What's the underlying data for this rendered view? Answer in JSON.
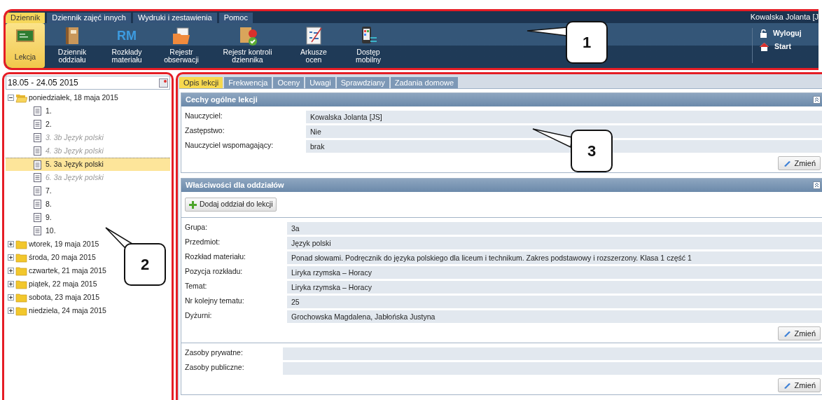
{
  "menu_tabs": [
    {
      "label": "Dziennik",
      "selected": true
    },
    {
      "label": "Dziennik zajęć innych",
      "selected": false
    },
    {
      "label": "Wydruki i zestawienia",
      "selected": false
    },
    {
      "label": "Pomoc",
      "selected": false
    }
  ],
  "user": "Kowalska Jolanta [J",
  "ribbon": [
    {
      "label": "Lekcja",
      "selected": true
    },
    {
      "label": "Dziennik oddziału",
      "selected": false
    },
    {
      "label": "Rozkłady materiału",
      "selected": false,
      "badge": "RM"
    },
    {
      "label": "Rejestr obserwacji",
      "selected": false
    },
    {
      "label": "Rejestr kontroli dziennika",
      "selected": false
    },
    {
      "label": "Arkusze ocen",
      "selected": false
    },
    {
      "label": "Dostęp mobilny",
      "selected": false
    }
  ],
  "account_actions": [
    {
      "label": "Wyloguj"
    },
    {
      "label": "Start"
    }
  ],
  "date_range": "18.05 - 24.05 2015",
  "tree": [
    {
      "label": "poniedziałek, 18 maja 2015",
      "expanded": true,
      "children": [
        {
          "label": "1.",
          "selected": false,
          "disabled": false
        },
        {
          "label": "2.",
          "selected": false,
          "disabled": false
        },
        {
          "label": "3. 3b Język polski",
          "selected": false,
          "disabled": true
        },
        {
          "label": "4. 3b Język polski",
          "selected": false,
          "disabled": true
        },
        {
          "label": "5. 3a Język polski",
          "selected": true,
          "disabled": false
        },
        {
          "label": "6. 3a Język polski",
          "selected": false,
          "disabled": true
        },
        {
          "label": "7.",
          "selected": false,
          "disabled": false
        },
        {
          "label": "8.",
          "selected": false,
          "disabled": false
        },
        {
          "label": "9.",
          "selected": false,
          "disabled": false
        },
        {
          "label": "10.",
          "selected": false,
          "disabled": false
        }
      ]
    },
    {
      "label": "wtorek, 19 maja 2015",
      "expanded": false
    },
    {
      "label": "środa, 20 maja 2015",
      "expanded": false
    },
    {
      "label": "czwartek, 21 maja 2015",
      "expanded": false
    },
    {
      "label": "piątek, 22 maja 2015",
      "expanded": false
    },
    {
      "label": "sobota, 23 maja 2015",
      "expanded": false
    },
    {
      "label": "niedziela, 24 maja 2015",
      "expanded": false
    }
  ],
  "content_tabs": [
    {
      "label": "Opis lekcji",
      "selected": true
    },
    {
      "label": "Frekwencja",
      "selected": false
    },
    {
      "label": "Oceny",
      "selected": false
    },
    {
      "label": "Uwagi",
      "selected": false
    },
    {
      "label": "Sprawdziany",
      "selected": false
    },
    {
      "label": "Zadania domowe",
      "selected": false
    }
  ],
  "sections": [
    {
      "title": "Cechy ogólne lekcji",
      "groups": [
        {
          "fields": [
            {
              "label": "Nauczyciel:",
              "value": "Kowalska Jolanta [JS]"
            },
            {
              "label": "Zastępstwo:",
              "value": "Nie"
            },
            {
              "label": "Nauczyciel wspomagający:",
              "value": "brak"
            }
          ],
          "button": "Zmień"
        }
      ]
    },
    {
      "title": "Właściwości dla oddziałów",
      "add_button": "Dodaj oddział do lekcji",
      "groups": [
        {
          "fields": [
            {
              "label": "Grupa:",
              "value": "3a"
            },
            {
              "label": "Przedmiot:",
              "value": "Język polski"
            },
            {
              "label": "Rozkład materiału:",
              "value": "Ponad słowami. Podręcznik do języka polskiego dla liceum i technikum. Zakres podstawowy i rozszerzony. Klasa 1 część 1"
            },
            {
              "label": "Pozycja rozkładu:",
              "value": "Liryka rzymska – Horacy"
            },
            {
              "label": "Temat:",
              "value": "Liryka rzymska – Horacy"
            },
            {
              "label": "Nr kolejny tematu:",
              "value": "25"
            },
            {
              "label": "Dyżurni:",
              "value": "Grochowska Magdalena, Jabłońska Justyna"
            }
          ],
          "button": "Zmień"
        },
        {
          "fields": [
            {
              "label": "Zasoby prywatne:"
            },
            {
              "label": "Zasoby publiczne:"
            }
          ],
          "button": "Zmień"
        }
      ]
    }
  ],
  "callouts": [
    {
      "label": "1"
    },
    {
      "label": "2"
    },
    {
      "label": "3"
    }
  ]
}
